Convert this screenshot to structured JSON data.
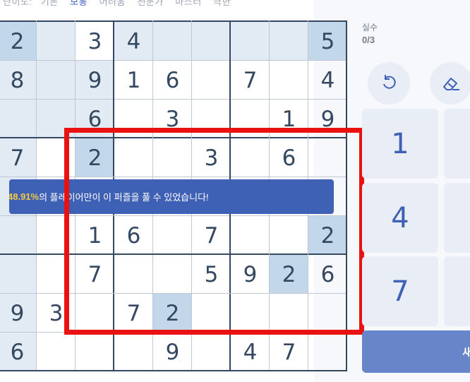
{
  "difficulty_tabs": {
    "prefix": "난이도:",
    "items": [
      {
        "label": "기본",
        "active": false
      },
      {
        "label": "보통",
        "active": true
      },
      {
        "label": "어려움",
        "active": false
      },
      {
        "label": "전문가",
        "active": false
      },
      {
        "label": "마스터",
        "active": false
      },
      {
        "label": "극한",
        "active": false
      }
    ]
  },
  "board": {
    "grid": [
      [
        "2",
        "",
        "3",
        "4",
        "",
        "",
        "",
        "",
        "5"
      ],
      [
        "8",
        "",
        "9",
        "1",
        "6",
        "",
        "7",
        "",
        "4"
      ],
      [
        "",
        "",
        "6",
        "",
        "3",
        "",
        "",
        "1",
        "9"
      ],
      [
        "7",
        "",
        "2",
        "",
        "",
        "3",
        "",
        "6",
        ""
      ],
      [
        "",
        "",
        "",
        "",
        "",
        "",
        "",
        "",
        ""
      ],
      [
        "",
        "",
        "1",
        "6",
        "",
        "7",
        "",
        "",
        "2"
      ],
      [
        "",
        "",
        "7",
        "",
        "",
        "5",
        "9",
        "2",
        "6"
      ],
      [
        "9",
        "3",
        "",
        "7",
        "2",
        "",
        "",
        "",
        ""
      ],
      [
        "6",
        "",
        "",
        "",
        "9",
        "",
        "4",
        "7",
        ""
      ]
    ],
    "highlight_cells": [
      [
        0,
        0
      ],
      [
        0,
        1
      ],
      [
        0,
        3
      ],
      [
        0,
        4
      ],
      [
        0,
        5
      ],
      [
        0,
        6
      ],
      [
        0,
        7
      ],
      [
        1,
        0
      ],
      [
        1,
        1
      ],
      [
        1,
        2
      ],
      [
        2,
        0
      ],
      [
        2,
        1
      ],
      [
        2,
        2
      ],
      [
        3,
        0
      ],
      [
        4,
        0
      ],
      [
        5,
        0
      ],
      [
        6,
        0
      ],
      [
        7,
        0
      ],
      [
        8,
        0
      ]
    ],
    "selected_cells": [
      [
        0,
        0
      ],
      [
        0,
        8
      ],
      [
        3,
        2
      ],
      [
        5,
        8
      ],
      [
        6,
        7
      ],
      [
        7,
        4
      ]
    ],
    "colors": {
      "digit": "#344861",
      "selected": "#c3d7ea",
      "highlight": "#e2ebf3",
      "thick_line": "#344861",
      "thin_line": "#bfc6d4"
    }
  },
  "banner": {
    "percent": "48.91%",
    "message": "의 플레이어만이 이 퍼즐을 풀 수 있었습니다!",
    "color": "#3f61b5"
  },
  "mistakes": {
    "label": "실수",
    "value": "0/3"
  },
  "tools": [
    {
      "name": "undo",
      "icon": "undo-icon"
    },
    {
      "name": "erase",
      "icon": "eraser-icon"
    }
  ],
  "numpad": {
    "keys": [
      "1",
      "4",
      "7"
    ]
  },
  "new_game_button": {
    "label": "새"
  },
  "annotation": {
    "box_color": "#ea1111"
  }
}
